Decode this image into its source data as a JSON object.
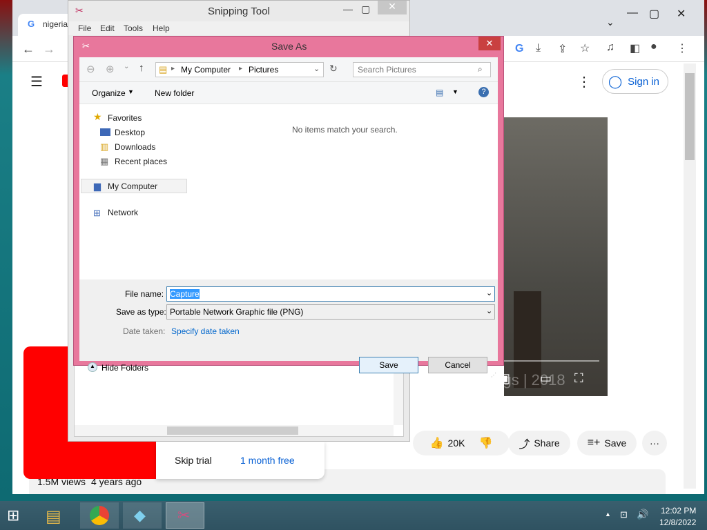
{
  "chrome": {
    "tab_title": "nigeria",
    "signin_label": "Sign in",
    "likes": "20K",
    "share_label": "Share",
    "save_label": "Save",
    "views": "1.5M views",
    "posted": "4 years ago",
    "skip_trial_label": "Skip trial",
    "month_free_label": "1 month free",
    "video_watermark": "©smashthings | 2018"
  },
  "snipping_tool": {
    "title": "Snipping Tool",
    "menu": [
      "File",
      "Edit",
      "Tools",
      "Help"
    ]
  },
  "save_as": {
    "title": "Save As",
    "breadcrumb": [
      "My Computer",
      "Pictures"
    ],
    "search_placeholder": "Search Pictures",
    "organize_label": "Organize",
    "new_folder_label": "New folder",
    "empty_message": "No items match your search.",
    "nav": {
      "favorites": "Favorites",
      "desktop": "Desktop",
      "downloads": "Downloads",
      "recent": "Recent places",
      "computer": "My Computer",
      "network": "Network"
    },
    "file_name_label": "File name:",
    "file_name_value": "Capture",
    "save_type_label": "Save as type:",
    "save_type_value": "Portable Network Graphic file (PNG)",
    "date_taken_label": "Date taken:",
    "date_taken_link": "Specify date taken",
    "hide_folders_label": "Hide Folders",
    "save_button": "Save",
    "cancel_button": "Cancel"
  },
  "taskbar": {
    "time": "12:02 PM",
    "date": "12/8/2022"
  }
}
